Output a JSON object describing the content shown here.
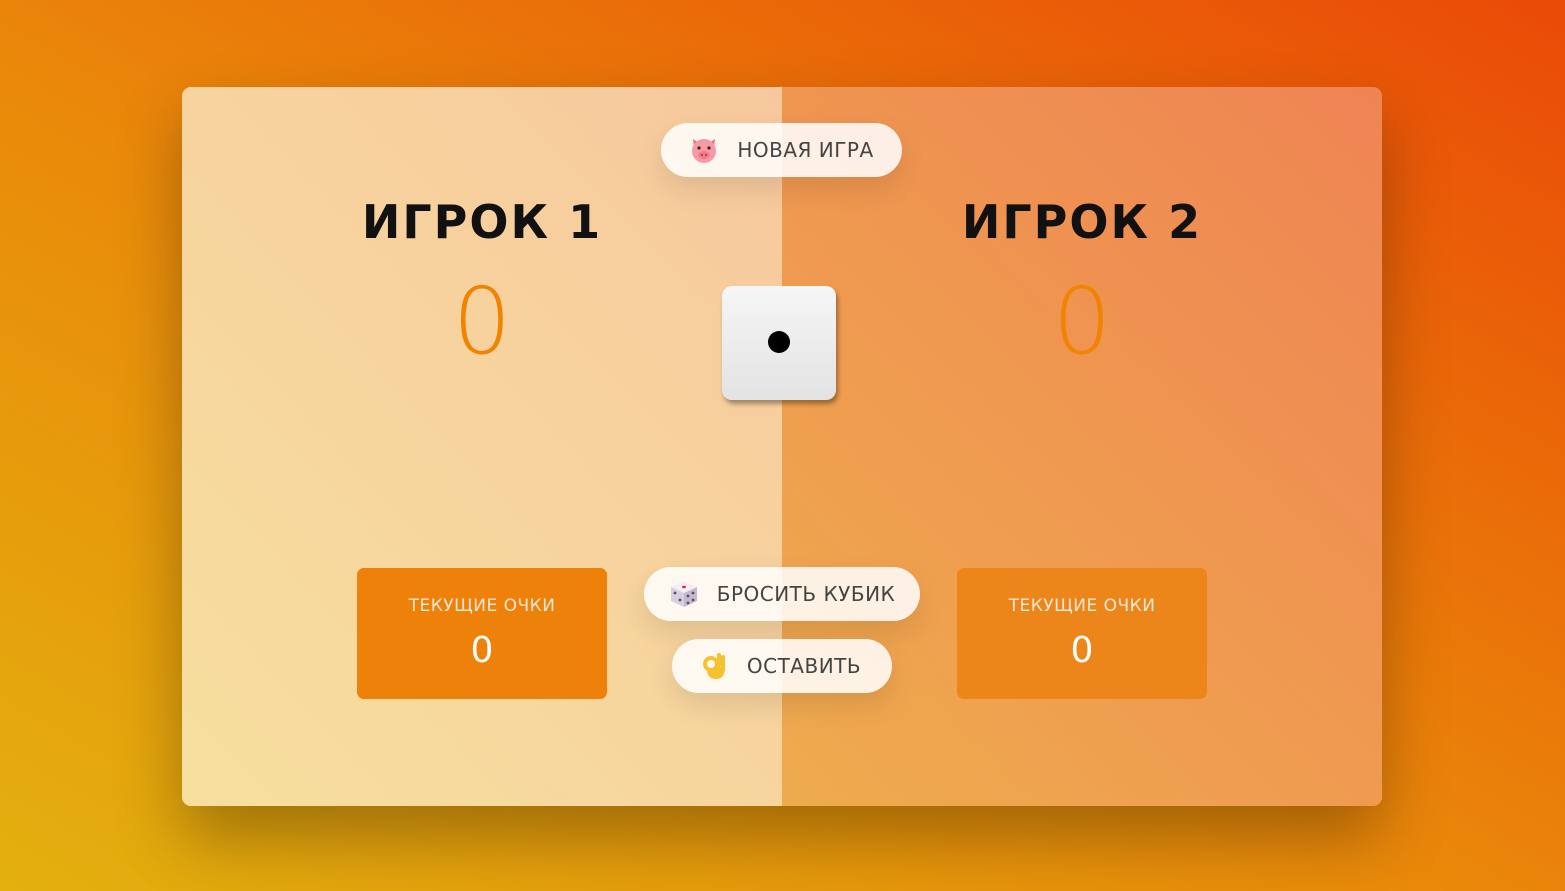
{
  "players": [
    {
      "name": "ИГРОК 1",
      "score": "0",
      "current_label": "ТЕКУЩИЕ ОЧКИ",
      "current_score": "0"
    },
    {
      "name": "ИГРОК 2",
      "score": "0",
      "current_label": "ТЕКУЩИЕ ОЧКИ",
      "current_score": "0"
    }
  ],
  "buttons": {
    "new_game": {
      "label": "НОВАЯ ИГРА",
      "icon": "pig-icon"
    },
    "roll": {
      "label": "БРОСИТЬ КУБИК",
      "icon": "dice-icon"
    },
    "hold": {
      "label": "ОСТАВИТЬ",
      "icon": "ok-hand-icon"
    }
  },
  "dice": {
    "value": 1
  },
  "colors": {
    "accent": "#f08400",
    "current_box_1": "#ee8109",
    "current_box_2": "#ec861a"
  }
}
